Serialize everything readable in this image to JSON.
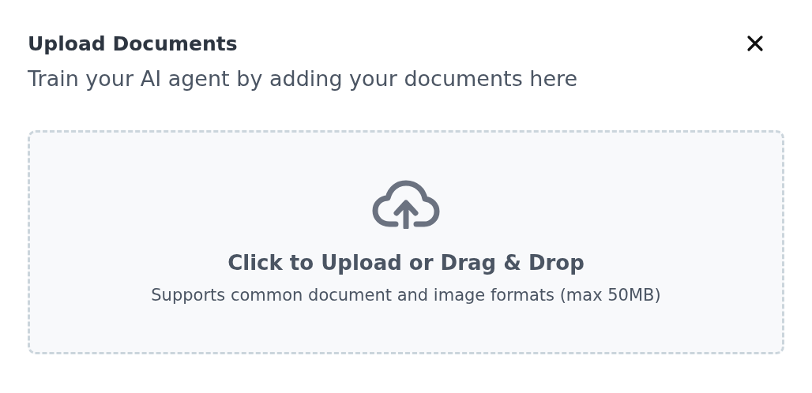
{
  "dialog": {
    "title": "Upload Documents",
    "subtitle": "Train your AI agent by adding your documents here"
  },
  "dropzone": {
    "heading": "Click to Upload or Drag & Drop",
    "hint": "Supports common document and image formats (max 50MB)"
  }
}
